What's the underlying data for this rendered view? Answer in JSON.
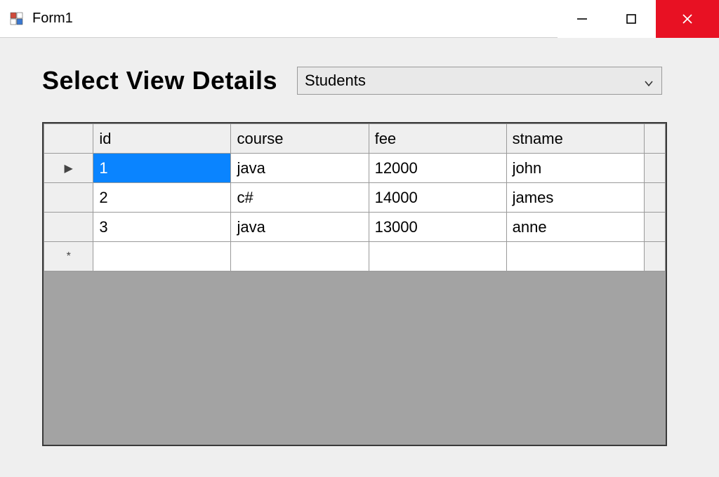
{
  "window": {
    "title": "Form1"
  },
  "header": {
    "label": "Select View Details",
    "combo_value": "Students"
  },
  "grid": {
    "columns": [
      "id",
      "course",
      "fee",
      "stname"
    ],
    "rows": [
      {
        "id": "1",
        "course": "java",
        "fee": "12000",
        "stname": "john"
      },
      {
        "id": "2",
        "course": "c#",
        "fee": "14000",
        "stname": "james"
      },
      {
        "id": "3",
        "course": "java",
        "fee": "13000",
        "stname": "anne"
      }
    ],
    "row_indicator": "▶",
    "new_row_indicator": "*",
    "selected": {
      "row": 0,
      "col": "id"
    }
  }
}
